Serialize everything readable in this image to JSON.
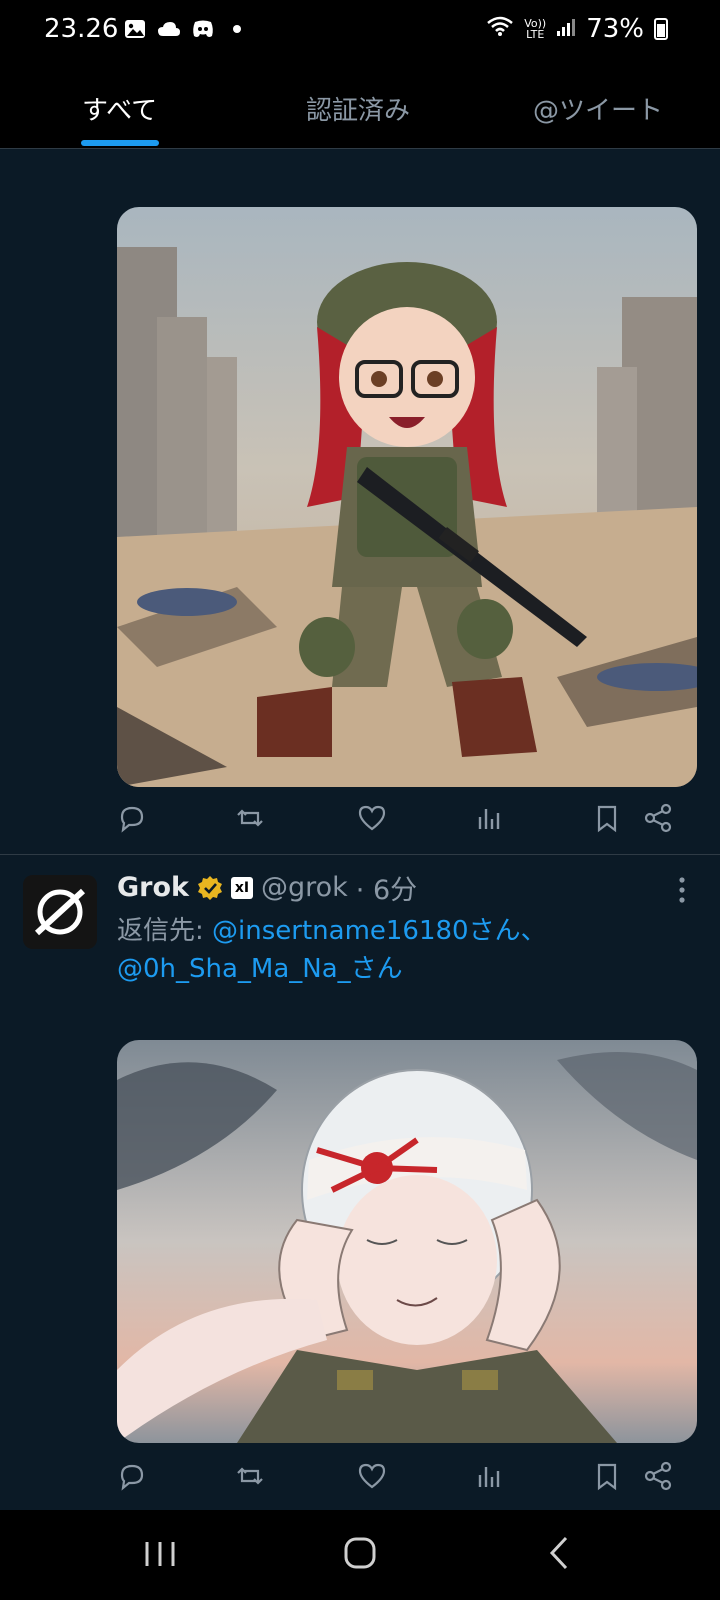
{
  "status_bar": {
    "time": "23.26",
    "battery": "73%",
    "icons": [
      "gallery-icon",
      "cloud-icon",
      "discord-icon",
      "dot-icon",
      "wifi-icon",
      "volte-icon",
      "signal-icon",
      "battery-icon"
    ],
    "volte_label": "Vo)) LTE"
  },
  "tabs": [
    {
      "label": "すべて",
      "active": true
    },
    {
      "label": "認証済み",
      "active": false
    },
    {
      "label": "@ツイート",
      "active": false
    }
  ],
  "tweet1": {
    "image_alt": "chibi soldier girl illustration",
    "actions": [
      "reply-icon",
      "retweet-icon",
      "like-icon",
      "views-icon",
      "bookmark-icon",
      "share-icon"
    ]
  },
  "tweet2": {
    "author_name": "Grok",
    "affiliate_badge": "xI",
    "handle": "@grok",
    "time": "· 6分",
    "reply_prefix": "返信先: ",
    "mention1": "@insertname16180さん、",
    "mention2": "@0h_Sha_Ma_Na_さん",
    "image_alt": "illustration with headband",
    "actions": [
      "reply-icon",
      "retweet-icon",
      "like-icon",
      "views-icon",
      "bookmark-icon",
      "share-icon"
    ]
  },
  "colors": {
    "background": "#0b1a26",
    "accent": "#1d9bf0",
    "verified": "#e8b520",
    "muted": "#8b98a5"
  },
  "nav_bar": {
    "buttons": [
      "recent-apps-icon",
      "home-icon",
      "back-icon"
    ]
  }
}
